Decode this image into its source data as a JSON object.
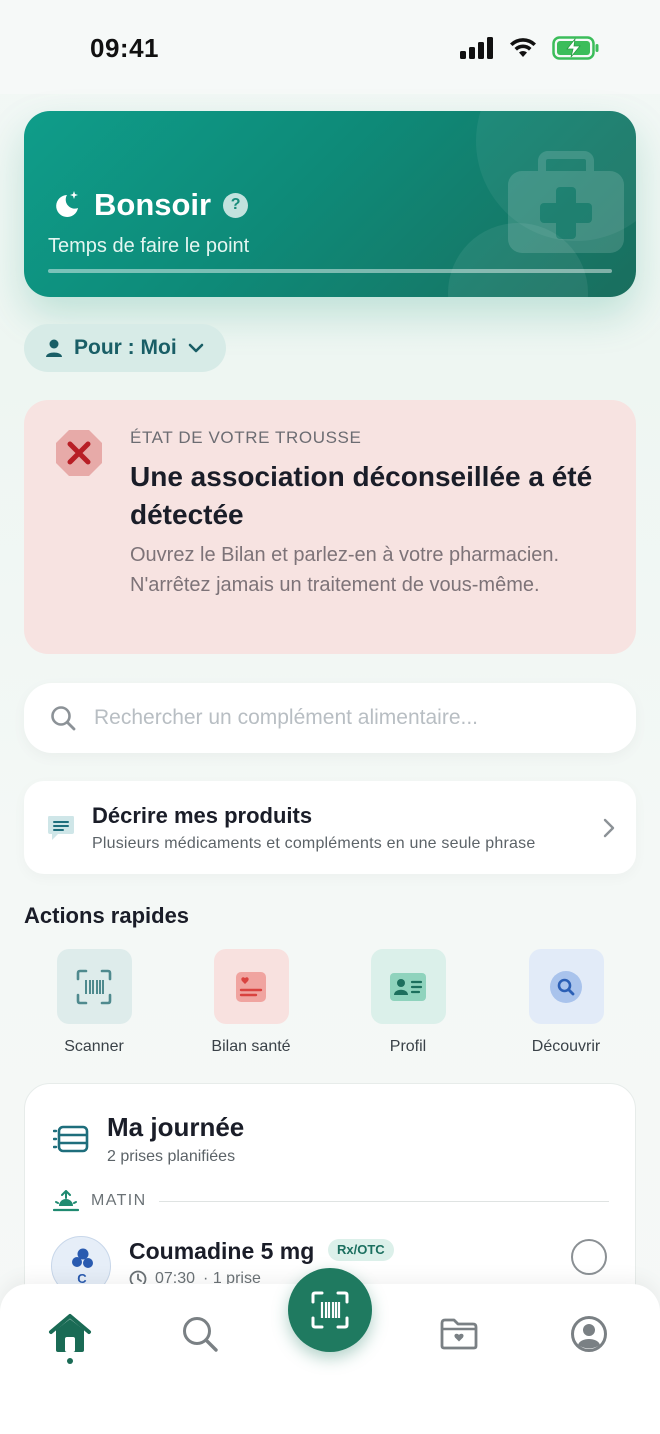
{
  "status_bar": {
    "time": "09:41"
  },
  "hero": {
    "title": "Bonsoir",
    "help": "?",
    "subtitle": "Temps de faire le point"
  },
  "profile_selector": {
    "label": "Pour : Moi"
  },
  "alert": {
    "kicker": "ÉTAT DE VOTRE TROUSSE",
    "title": "Une association déconseillée a été détectée",
    "body": "Ouvrez le Bilan et parlez-en à votre pharmacien. N'arrêtez jamais un traitement de vous-même.",
    "color": "#f7e3e1"
  },
  "search": {
    "placeholder": "Rechercher un complément alimentaire...",
    "value": ""
  },
  "describe": {
    "title": "Décrire mes produits",
    "subtitle": "Plusieurs médicaments et compléments en une seule phrase"
  },
  "quick_actions": {
    "title": "Actions rapides",
    "items": [
      {
        "label": "Scanner",
        "icon": "barcode-scan-icon",
        "color": "#deeceb"
      },
      {
        "label": "Bilan santé",
        "icon": "health-report-icon",
        "color": "#f8e1df"
      },
      {
        "label": "Profil",
        "icon": "profile-card-icon",
        "color": "#dbf0ea"
      },
      {
        "label": "Découvrir",
        "icon": "discover-search-icon",
        "color": "#e2ebf8"
      }
    ]
  },
  "day": {
    "title": "Ma journée",
    "subtitle": "2 prises planifiées",
    "period": "MATIN",
    "medication": {
      "avatar_letter": "C",
      "name": "Coumadine 5 mg",
      "badge": "Rx/OTC",
      "time": "07:30",
      "doses": "· 1 prise"
    }
  },
  "tabbar": {
    "items": [
      "home-icon",
      "search-icon",
      "barcode-scan-icon",
      "health-folder-icon",
      "account-icon"
    ],
    "active": "home-icon"
  },
  "colors": {
    "brand": "#1f7a60",
    "hero": "#0f9d8a",
    "danger": "#c0282d"
  }
}
